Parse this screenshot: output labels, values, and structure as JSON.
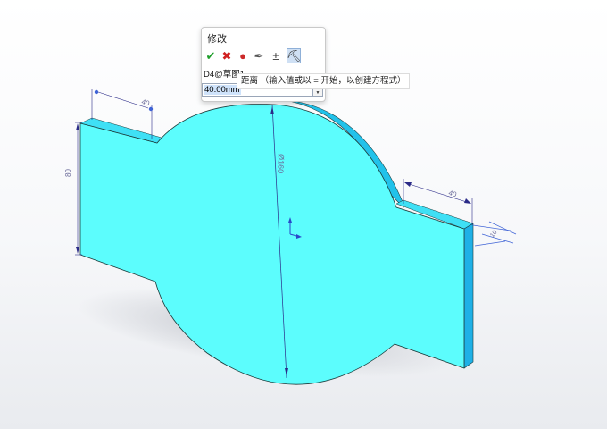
{
  "modify_dialog": {
    "title": "修改",
    "toolbar": [
      {
        "name": "ok-check-icon",
        "glyph": "✔",
        "color": "#1e9e2a"
      },
      {
        "name": "cancel-x-icon",
        "glyph": "✖",
        "color": "#d02020"
      },
      {
        "name": "rebuild-traffic-light-icon",
        "glyph": "●",
        "color": "#cc2a2a"
      },
      {
        "name": "save-pin-icon",
        "glyph": "✒",
        "color": "#555555"
      },
      {
        "name": "reset-spin-icon",
        "glyph": "±",
        "color": "#333333"
      },
      {
        "name": "mark-dimension-icon",
        "glyph": "⛏",
        "color": "#333333"
      }
    ],
    "dimension_name": "D4@草图1",
    "value": "40.00mm",
    "hint": "距离 （输入值或以 = 开始，以创建方程式）"
  },
  "dimensions": {
    "top_left_width": "40",
    "left_height": "80",
    "diameter": "Ø160",
    "right_width": "40",
    "right_depth": "10"
  },
  "colors": {
    "part_face": "#5cfdfd",
    "part_side": "#22c2ea",
    "part_edge": "#1a3a3a",
    "dimension_line": "#2b2b88",
    "dimension_text": "#6b6b9a",
    "selected_dimension": "#3f63d6"
  }
}
